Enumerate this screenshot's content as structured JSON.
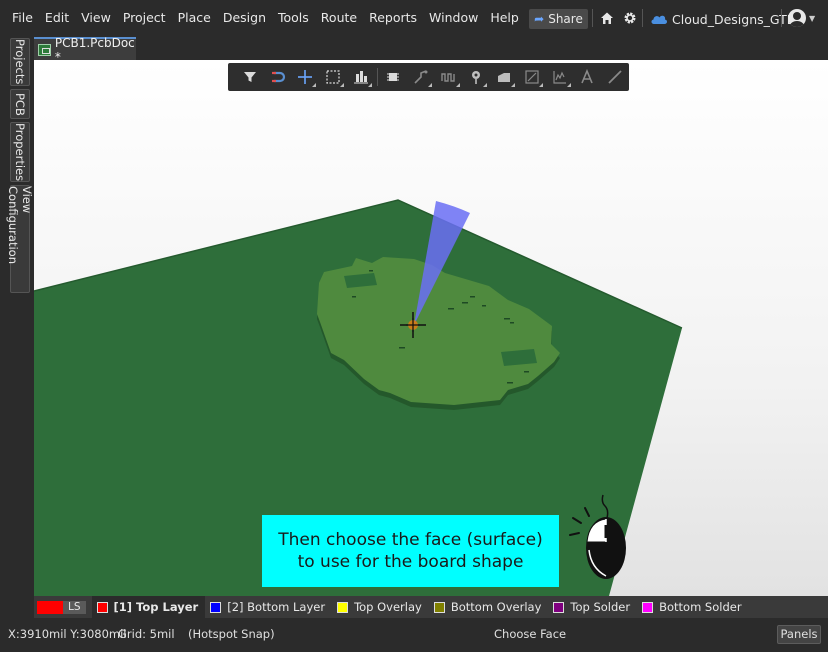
{
  "menu": [
    "File",
    "Edit",
    "View",
    "Project",
    "Place",
    "Design",
    "Tools",
    "Route",
    "Reports",
    "Window",
    "Help"
  ],
  "header": {
    "share_label": "Share",
    "workspace_name": "Cloud_Designs_GTD"
  },
  "side_tabs": [
    "Projects",
    "PCB",
    "Properties",
    "View Configuration"
  ],
  "document_tab": "PCB1.PcbDoc *",
  "toolbar": {
    "icons": [
      "filter-icon",
      "interactive-route-magnet-icon",
      "crosshair-place-icon",
      "select-rectangle-icon",
      "align-icon",
      "component-icon",
      "route-icon",
      "length-tune-icon",
      "pad-via-icon",
      "fill-icon",
      "dimension-icon",
      "chart-icon",
      "text-icon",
      "line-icon"
    ]
  },
  "caption": {
    "line1": "Then choose the face (surface)",
    "line2": "to use for the board shape"
  },
  "layers": {
    "ls_label": "LS",
    "items": [
      {
        "label": "[1] Top Layer",
        "color": "#ff0000",
        "active": true
      },
      {
        "label": "[2] Bottom Layer",
        "color": "#0000ff",
        "active": false
      },
      {
        "label": "Top Overlay",
        "color": "#ffff00",
        "active": false
      },
      {
        "label": "Bottom Overlay",
        "color": "#808000",
        "active": false
      },
      {
        "label": "Top Solder",
        "color": "#800080",
        "active": false
      },
      {
        "label": "Bottom Solder",
        "color": "#ff00ff",
        "active": false
      }
    ]
  },
  "status": {
    "coords": "X:3910mil Y:3080mil",
    "grid": "Grid: 5mil",
    "snap": "(Hotspot Snap)",
    "message": "Choose Face",
    "panels_label": "Panels"
  },
  "colors": {
    "board_green": "#2e6e3a",
    "shape_green": "#4f8a3e",
    "caption_bg": "#00ffff",
    "accent_blue": "#5a8fd0"
  }
}
